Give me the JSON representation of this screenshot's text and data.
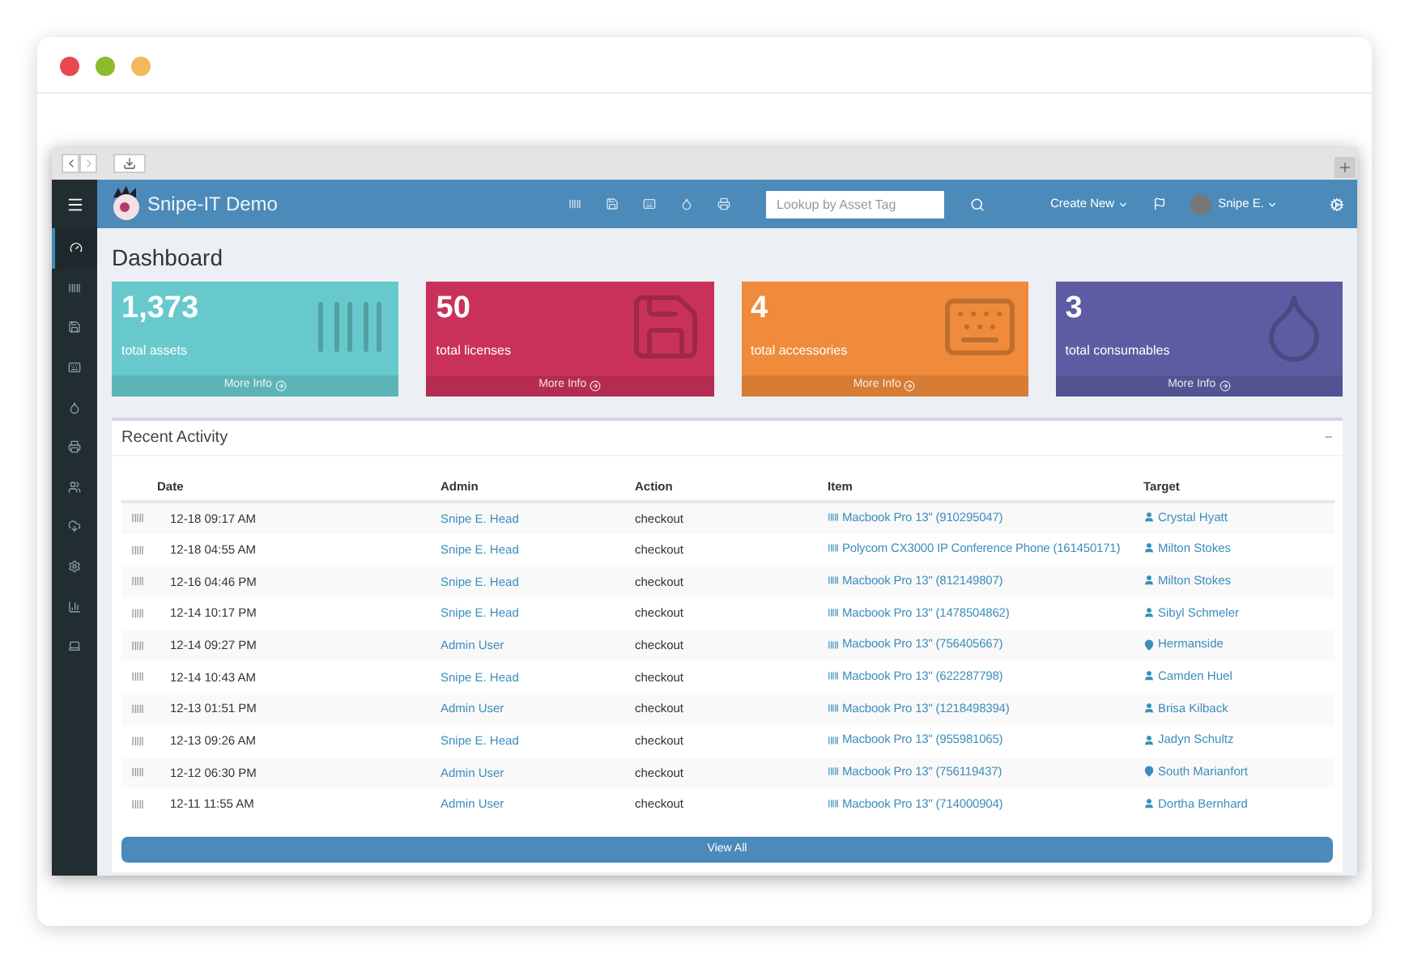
{
  "app": {
    "title": "Snipe-IT Demo"
  },
  "search": {
    "placeholder": "Lookup by Asset Tag"
  },
  "header": {
    "create_new": "Create New",
    "user": "Snipe E."
  },
  "sidebar": {
    "items": [
      {
        "selected": true
      },
      {
        "selected": false
      },
      {
        "selected": false
      },
      {
        "selected": false
      },
      {
        "selected": false
      },
      {
        "selected": false
      },
      {
        "selected": false
      },
      {
        "selected": false
      },
      {
        "selected": false
      },
      {
        "selected": false
      },
      {
        "selected": false
      }
    ]
  },
  "page": {
    "title": "Dashboard"
  },
  "tiles": [
    {
      "count": "1,373",
      "label": "total assets",
      "link": "More Info",
      "color": "#67c9cc"
    },
    {
      "count": "50",
      "label": "total licenses",
      "link": "More Info",
      "color": "#c9315b"
    },
    {
      "count": "4",
      "label": "total accessories",
      "link": "More Info",
      "color": "#ef8b3a"
    },
    {
      "count": "3",
      "label": "total consumables",
      "link": "More Info",
      "color": "#5d5ca3"
    }
  ],
  "recent_activity": {
    "title": "Recent Activity",
    "collapse": "−",
    "columns": [
      "Date",
      "Admin",
      "Action",
      "Item",
      "Target"
    ],
    "rows": [
      {
        "date": "12-18 09:17 AM",
        "admin": "Snipe E. Head",
        "action": "checkout",
        "item": "Macbook Pro 13\" (910295047)",
        "target": "Crystal Hyatt",
        "kind": "person"
      },
      {
        "date": "12-18 04:55 AM",
        "admin": "Snipe E. Head",
        "action": "checkout",
        "item": "Polycom CX3000 IP Conference Phone (161450171)",
        "target": "Milton Stokes",
        "kind": "person"
      },
      {
        "date": "12-16 04:46 PM",
        "admin": "Snipe E. Head",
        "action": "checkout",
        "item": "Macbook Pro 13\" (812149807)",
        "target": "Milton Stokes",
        "kind": "person"
      },
      {
        "date": "12-14 10:17 PM",
        "admin": "Snipe E. Head",
        "action": "checkout",
        "item": "Macbook Pro 13\" (1478504862)",
        "target": "Sibyl Schmeler",
        "kind": "person"
      },
      {
        "date": "12-14 09:27 PM",
        "admin": "Admin User",
        "action": "checkout",
        "item": "Macbook Pro 13\" (756405667)",
        "target": "Hermanside",
        "kind": "location"
      },
      {
        "date": "12-14 10:43 AM",
        "admin": "Snipe E. Head",
        "action": "checkout",
        "item": "Macbook Pro 13\" (622287798)",
        "target": "Camden Huel",
        "kind": "person"
      },
      {
        "date": "12-13 01:51 PM",
        "admin": "Admin User",
        "action": "checkout",
        "item": "Macbook Pro 13\" (1218498394)",
        "target": "Brisa Kilback",
        "kind": "person"
      },
      {
        "date": "12-13 09:26 AM",
        "admin": "Snipe E. Head",
        "action": "checkout",
        "item": "Macbook Pro 13\" (955981065)",
        "target": "Jadyn Schultz",
        "kind": "person"
      },
      {
        "date": "12-12 06:30 PM",
        "admin": "Admin User",
        "action": "checkout",
        "item": "Macbook Pro 13\" (756119437)",
        "target": "South Marianfort",
        "kind": "location"
      },
      {
        "date": "12-11 11:55 AM",
        "admin": "Admin User",
        "action": "checkout",
        "item": "Macbook Pro 13\" (714000904)",
        "target": "Dortha Bernhard",
        "kind": "person"
      }
    ],
    "view_all": "View All"
  }
}
